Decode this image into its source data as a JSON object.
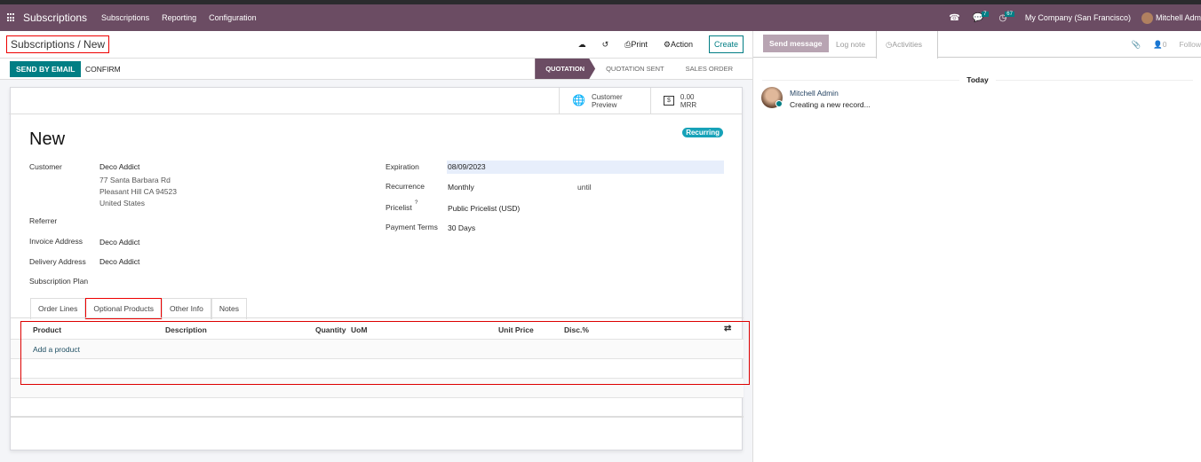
{
  "navbar": {
    "app": "Subscriptions",
    "menus": [
      "Subscriptions",
      "Reporting",
      "Configuration"
    ],
    "messages_count": "7",
    "activities_count": "67",
    "company": "My Company (San Francisco)",
    "user": "Mitchell Adm"
  },
  "control_panel": {
    "breadcrumb": "Subscriptions / New",
    "print": "Print",
    "action": "Action",
    "create": "Create"
  },
  "statusbar": {
    "send_by_email": "SEND BY EMAIL",
    "confirm": "CONFIRM",
    "stages": [
      "QUOTATION",
      "QUOTATION SENT",
      "SALES ORDER"
    ],
    "active_stage": "QUOTATION"
  },
  "buttons": {
    "customer_preview_1": "Customer",
    "customer_preview_2": "Preview",
    "mrr_value": "0.00",
    "mrr_label": "MRR"
  },
  "form": {
    "title": "New",
    "badge": "Recurring",
    "customer_label": "Customer",
    "customer": "Deco Addict",
    "addr1": "77 Santa Barbara Rd",
    "addr2": "Pleasant Hill CA 94523",
    "addr3": "United States",
    "referrer_label": "Referrer",
    "invoice_label": "Invoice Address",
    "invoice": "Deco Addict",
    "delivery_label": "Delivery Address",
    "delivery": "Deco Addict",
    "plan_label": "Subscription Plan",
    "expiration_label": "Expiration",
    "expiration": "08/09/2023",
    "recurrence_label": "Recurrence",
    "recurrence": "Monthly",
    "until": "until",
    "pricelist_label": "Pricelist",
    "pricelist_help": "?",
    "pricelist": "Public Pricelist (USD)",
    "terms_label": "Payment Terms",
    "terms": "30 Days"
  },
  "tabs": [
    "Order Lines",
    "Optional Products",
    "Other Info",
    "Notes"
  ],
  "selected_tab": "Optional Products",
  "table": {
    "columns": [
      "Product",
      "Description",
      "Quantity",
      "UoM",
      "Unit Price",
      "Disc.%"
    ],
    "add": "Add a product"
  },
  "chatter": {
    "send_message": "Send message",
    "log_note": "Log note",
    "activities": "Activities",
    "followers_count": "0",
    "follow": "Follow",
    "today": "Today",
    "author": "Mitchell Admin",
    "message": "Creating a new record..."
  }
}
